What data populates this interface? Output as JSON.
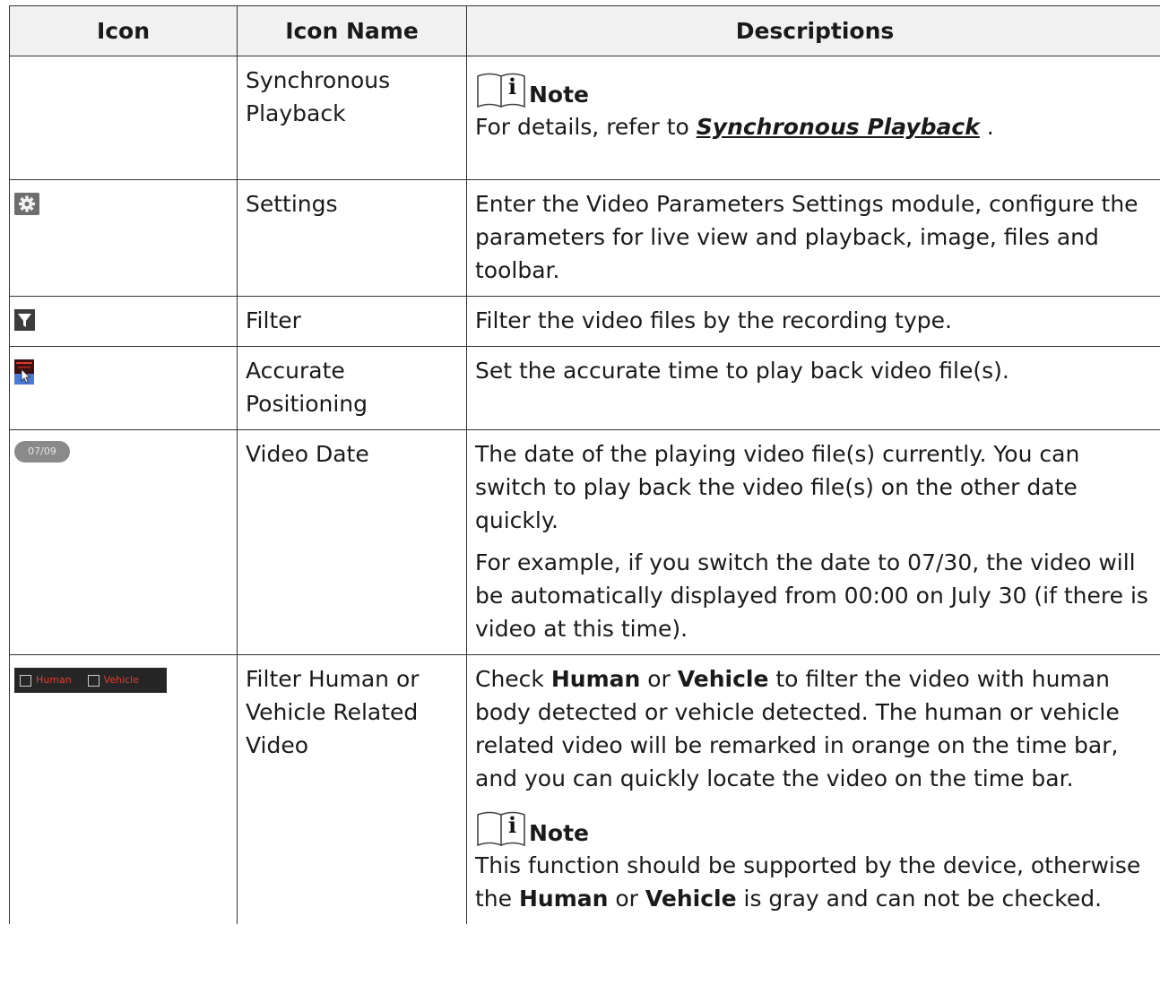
{
  "header": {
    "col_icon": "Icon",
    "col_name": "Icon Name",
    "col_desc": "Descriptions"
  },
  "rows": [
    {
      "icon": "",
      "name": "Synchronous Playback",
      "note_label": "Note",
      "desc_prefix": "For details, refer to ",
      "desc_link": "Synchronous Playback",
      "desc_suffix": " ."
    },
    {
      "icon": "gear-icon",
      "name": "Settings",
      "desc": "Enter the Video Parameters Settings module, configure the parameters for live view and playback, image, files and toolbar."
    },
    {
      "icon": "filter-funnel-icon",
      "name": "Filter",
      "desc": "Filter the video files by the recording type."
    },
    {
      "icon": "accurate-positioning-icon",
      "name": "Accurate Positioning",
      "desc": "Set the accurate time to play back video file(s)."
    },
    {
      "icon": "video-date-icon",
      "icon_text": "07/09",
      "name": "Video Date",
      "desc_1": "The date of the playing video file(s) currently. You can switch to play back the video file(s) on the other date quickly.",
      "desc_2": "For example, if you switch the date to 07/30, the video will be automatically displayed from 00:00 on July 30 (if there is video at this time)."
    },
    {
      "icon": "human-vehicle-checkbox-icon",
      "icon_human": "Human",
      "icon_vehicle": "Vehicle",
      "name": "Filter Human or Vehicle Related Video",
      "p1_a": "Check ",
      "p1_human": "Human",
      "p1_b": " or ",
      "p1_vehicle": "Vehicle",
      "p1_c": " to filter the video with human body detected or vehicle detected. The human or vehicle related video will be remarked in orange on the time bar, and you can quickly locate the video on the time bar.",
      "note_label": "Note",
      "p2_a": "This function should be supported by the device, otherwise the ",
      "p2_human": "Human",
      "p2_b": " or ",
      "p2_vehicle": "Vehicle",
      "p2_c": " is gray and can not be checked."
    }
  ],
  "colors": {
    "header_bg": "#f1f1f1",
    "border": "#333333",
    "hv_text": "#e53e30"
  }
}
